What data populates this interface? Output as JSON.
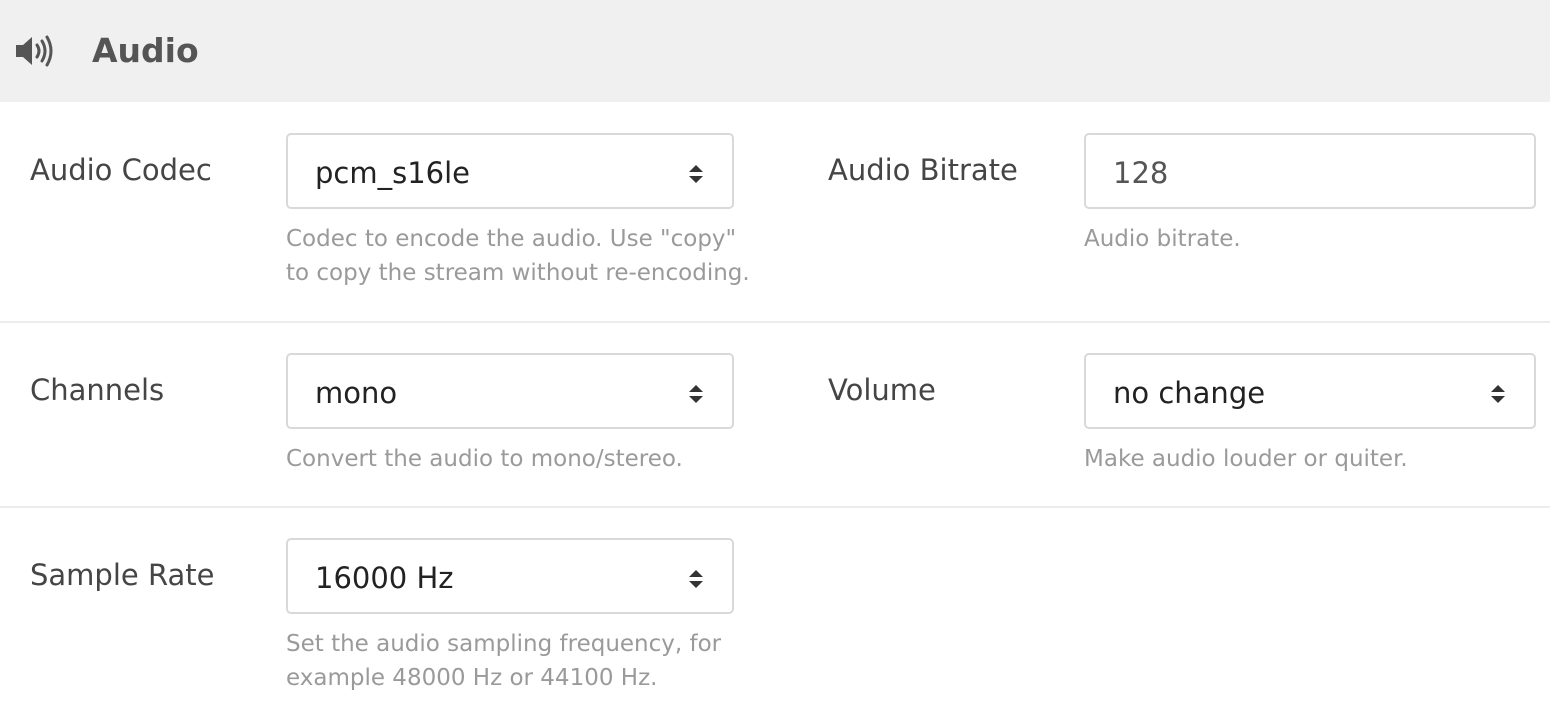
{
  "section": {
    "title": "Audio",
    "icon": "speaker-volume-icon"
  },
  "fields": {
    "audio_codec": {
      "label": "Audio Codec",
      "value": "pcm_s16le",
      "help_line1": "Codec to encode the audio. Use \"copy\"",
      "help_line2": "to copy the stream without re-encoding."
    },
    "audio_bitrate": {
      "label": "Audio Bitrate",
      "value": "128",
      "help": "Audio bitrate."
    },
    "channels": {
      "label": "Channels",
      "value": "mono",
      "help": "Convert the audio to mono/stereo."
    },
    "volume": {
      "label": "Volume",
      "value": "no change",
      "help": "Make audio louder or quiter."
    },
    "sample_rate": {
      "label": "Sample Rate",
      "value": "16000 Hz",
      "help_line1": "Set the audio sampling frequency, for",
      "help_line2": "example 48000 Hz or 44100 Hz."
    }
  },
  "colors": {
    "header_bg": "#f0f0f0",
    "border": "#d9d9d9",
    "help_text": "#9a9a9a"
  }
}
